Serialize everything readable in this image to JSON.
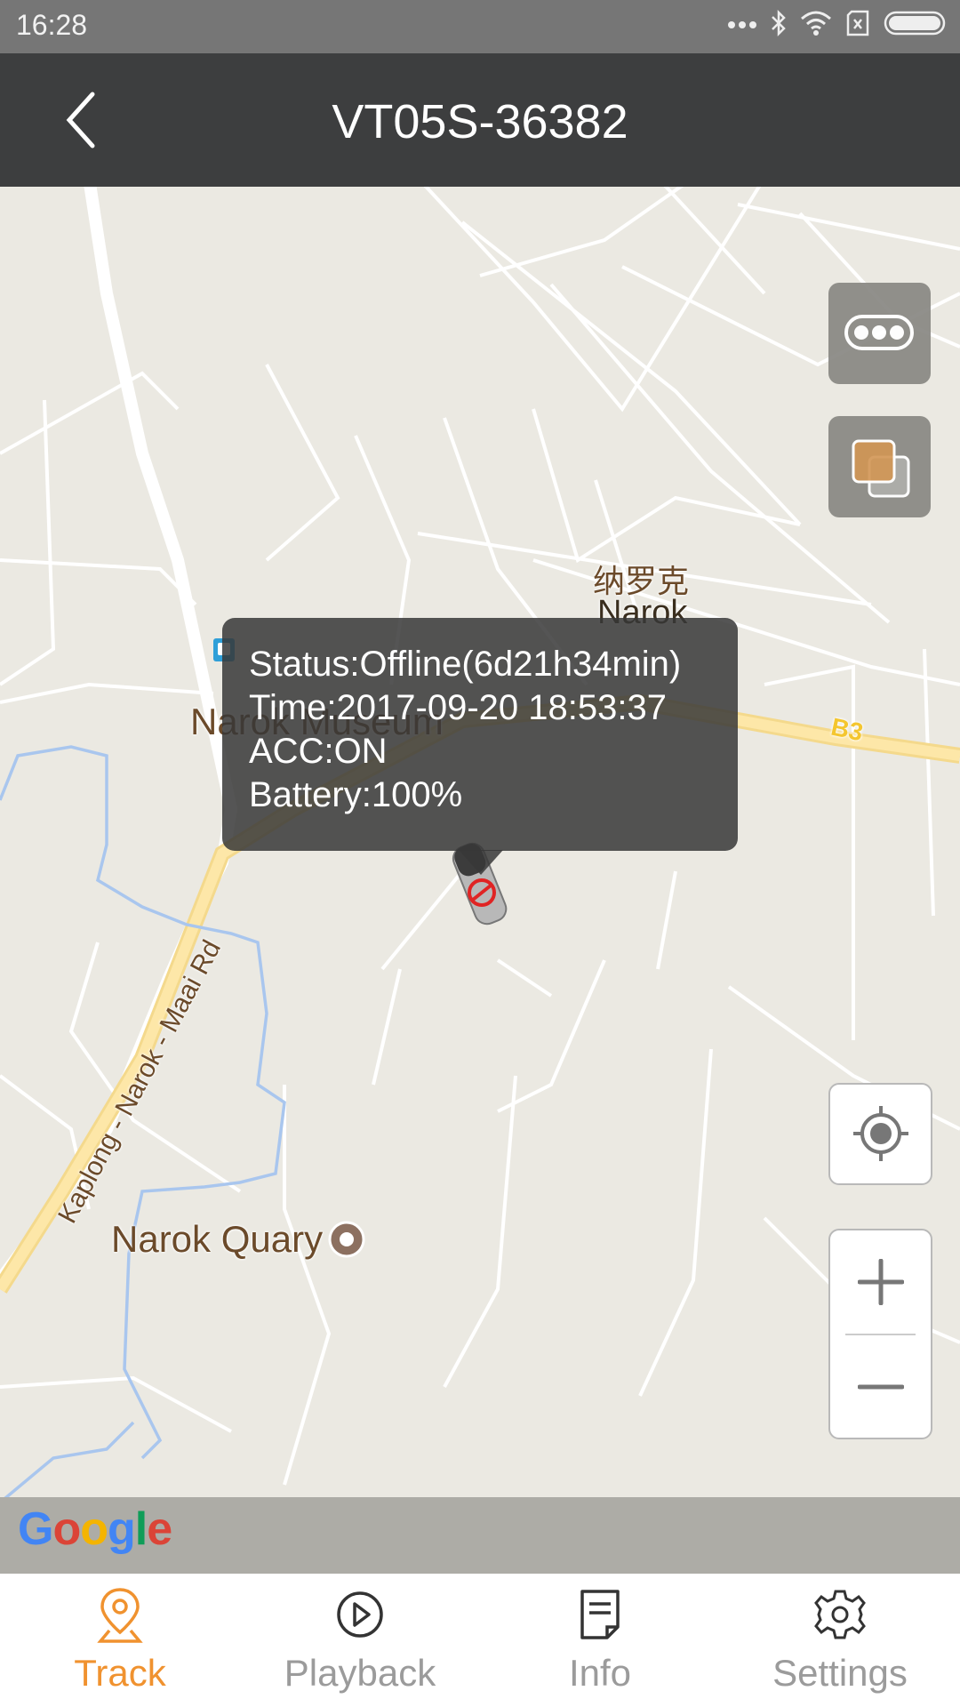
{
  "status_bar": {
    "time": "16:28",
    "icons": [
      "more-dots-icon",
      "bluetooth-icon",
      "wifi-icon",
      "no-sim-icon",
      "battery-icon"
    ]
  },
  "header": {
    "back_icon": "chevron-left-icon",
    "title": "VT05S-36382"
  },
  "map": {
    "labels": {
      "city_cn": "纳罗克",
      "city_en": "Narok",
      "museum": "Narok Museum",
      "quarry": "Narok Quary",
      "road_b3": "B3",
      "road_kaplong": "Kaplong - Narok - Maai Rd"
    },
    "controls": {
      "more_icon": "more-icon",
      "layers_icon": "layers-icon",
      "locate_icon": "locate-icon",
      "zoom_in": "+",
      "zoom_out": "−"
    },
    "vehicle_popup": {
      "status": "Status:Offline(6d21h34min)",
      "time": "Time:2017-09-20 18:53:37",
      "acc": "ACC:ON",
      "battery": "Battery:100%"
    },
    "attribution": "Google"
  },
  "colors": {
    "accent": "#f0922f",
    "header_bg": "#3d3e3f",
    "inactive_tab": "#9b9b9b"
  },
  "bottom_nav": {
    "tabs": [
      {
        "label": "Track",
        "icon": "location-pin-icon",
        "active": true
      },
      {
        "label": "Playback",
        "icon": "play-circle-icon",
        "active": false
      },
      {
        "label": "Info",
        "icon": "document-icon",
        "active": false
      },
      {
        "label": "Settings",
        "icon": "gear-icon",
        "active": false
      }
    ]
  }
}
